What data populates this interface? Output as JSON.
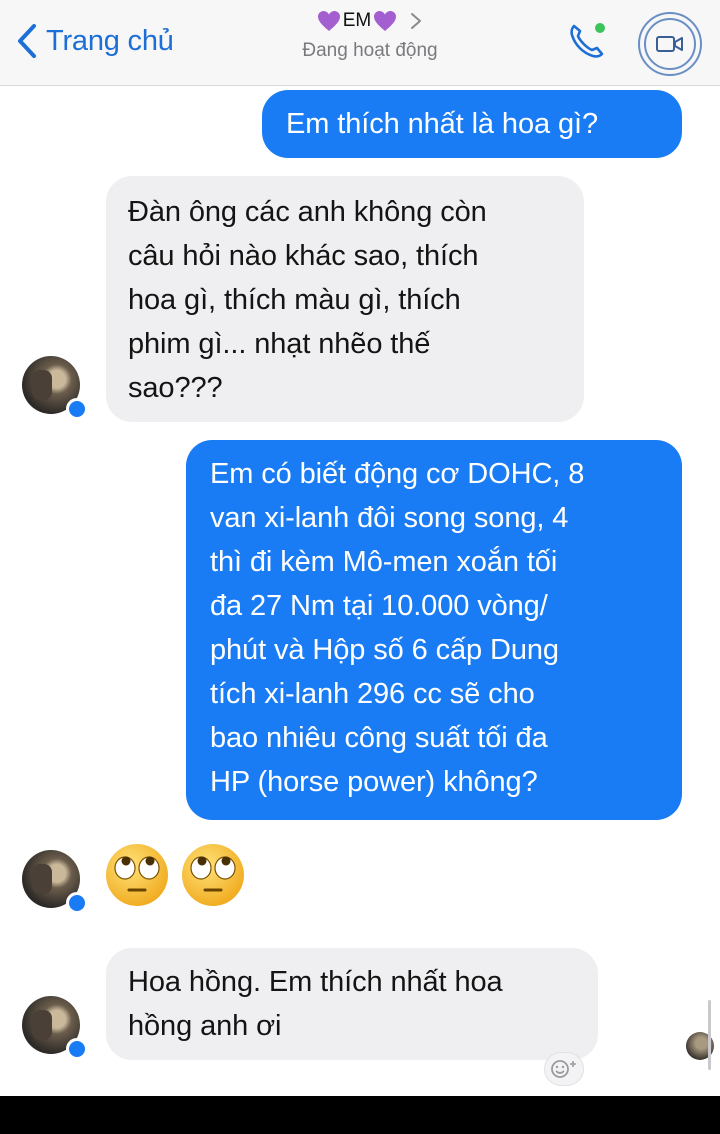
{
  "header": {
    "back_label": "Trang chủ",
    "contact_name": "EM",
    "status": "Đang hoạt động"
  },
  "messages": [
    {
      "direction": "outgoing",
      "lines": [
        "Em thích nhất là hoa gì?"
      ]
    },
    {
      "direction": "incoming",
      "lines": [
        "Đàn ông các anh không còn",
        "câu hỏi nào khác sao, thích",
        "hoa gì, thích màu gì, thích",
        "phim gì... nhạt nhẽo thế",
        "sao???"
      ]
    },
    {
      "direction": "outgoing",
      "lines": [
        "Em có biết động cơ DOHC, 8",
        "van xi-lanh đôi song song, 4",
        "thì đi kèm Mô-men xoắn tối",
        "đa 27 Nm tại 10.000 vòng/",
        "phút và Hộp số 6 cấp Dung",
        "tích xi-lanh 296 cc sẽ cho",
        "bao nhiêu công suất tối đa",
        "HP (horse power) không?"
      ]
    },
    {
      "direction": "incoming",
      "emoji": [
        "face-with-rolling-eyes-icon",
        "face-with-rolling-eyes-icon"
      ]
    },
    {
      "direction": "incoming",
      "lines": [
        "Hoa hồng. Em thích nhất hoa",
        "hồng anh ơi"
      ]
    }
  ],
  "colors": {
    "accent": "#1a7cf5",
    "incoming_bubble": "#efeff1",
    "heart": "#a35fd0"
  }
}
